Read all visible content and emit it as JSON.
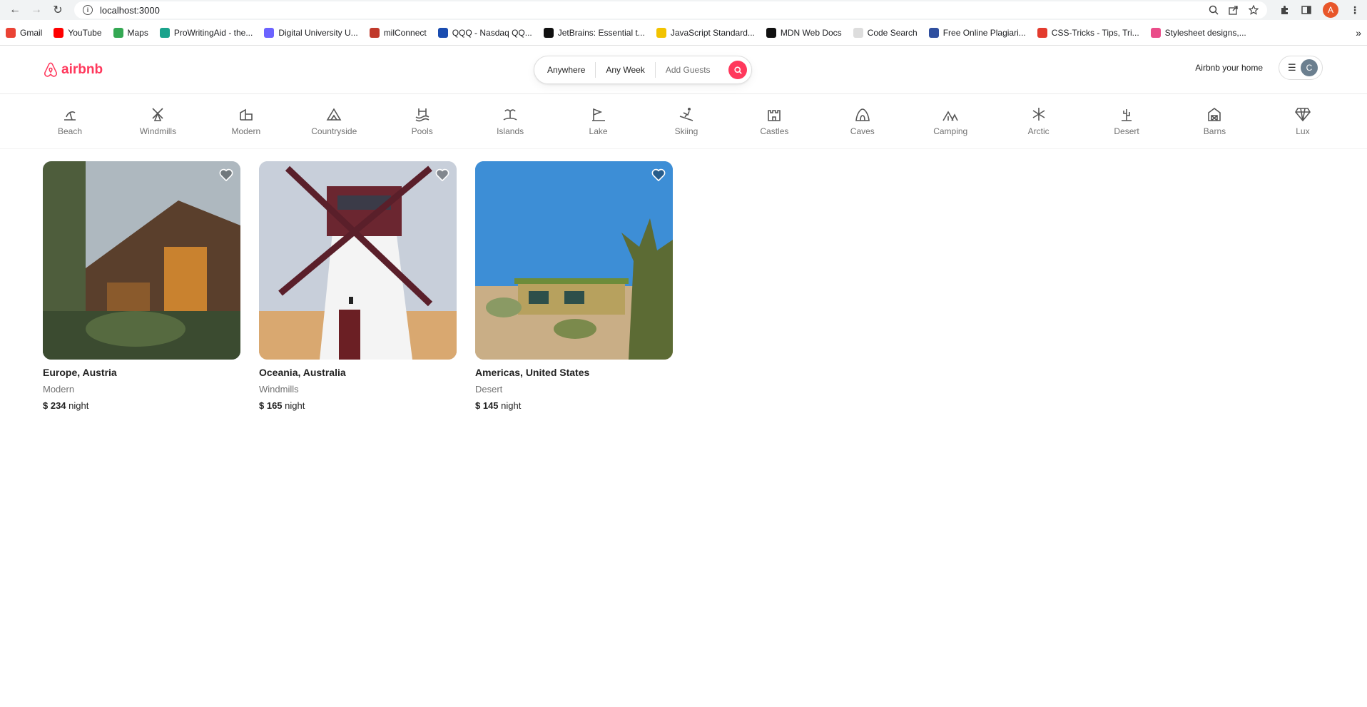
{
  "browser": {
    "url": "localhost:3000",
    "profile_initial": "A",
    "bookmarks": [
      {
        "label": "Gmail",
        "color": "#ea4335"
      },
      {
        "label": "YouTube",
        "color": "#ff0000"
      },
      {
        "label": "Maps",
        "color": "#34a853"
      },
      {
        "label": "ProWritingAid - the...",
        "color": "#1aa38c"
      },
      {
        "label": "Digital University U...",
        "color": "#6c63ff"
      },
      {
        "label": "milConnect",
        "color": "#c0392b"
      },
      {
        "label": "QQQ - Nasdaq QQ...",
        "color": "#1a4cb0"
      },
      {
        "label": "JetBrains: Essential t...",
        "color": "#111111"
      },
      {
        "label": "JavaScript Standard...",
        "color": "#f2c300"
      },
      {
        "label": "MDN Web Docs",
        "color": "#111111"
      },
      {
        "label": "Code Search",
        "color": "#dddddd"
      },
      {
        "label": "Free Online Plagiari...",
        "color": "#2f4f9f"
      },
      {
        "label": "CSS-Tricks - Tips, Tri...",
        "color": "#e33b2e"
      },
      {
        "label": "Stylesheet designs,...",
        "color": "#ea4c89"
      }
    ],
    "more_label": "»"
  },
  "header": {
    "logo_text": "airbnb",
    "search": {
      "anywhere": "Anywhere",
      "any_week": "Any Week",
      "add_guests": "Add Guests"
    },
    "host_link": "Airbnb your home",
    "avatar_initial": "C",
    "brand_color": "#ff385c"
  },
  "categories": [
    {
      "label": "Beach",
      "icon": "beach-icon"
    },
    {
      "label": "Windmills",
      "icon": "windmill-icon"
    },
    {
      "label": "Modern",
      "icon": "modern-icon"
    },
    {
      "label": "Countryside",
      "icon": "countryside-icon"
    },
    {
      "label": "Pools",
      "icon": "pool-icon"
    },
    {
      "label": "Islands",
      "icon": "island-icon"
    },
    {
      "label": "Lake",
      "icon": "lake-icon"
    },
    {
      "label": "Skiing",
      "icon": "skiing-icon"
    },
    {
      "label": "Castles",
      "icon": "castle-icon"
    },
    {
      "label": "Caves",
      "icon": "cave-icon"
    },
    {
      "label": "Camping",
      "icon": "camping-icon"
    },
    {
      "label": "Arctic",
      "icon": "arctic-icon"
    },
    {
      "label": "Desert",
      "icon": "desert-icon"
    },
    {
      "label": "Barns",
      "icon": "barn-icon"
    },
    {
      "label": "Lux",
      "icon": "lux-icon"
    }
  ],
  "listings": [
    {
      "location": "Europe, Austria",
      "category": "Modern",
      "price": "$ 234",
      "unit": "night"
    },
    {
      "location": "Oceania, Australia",
      "category": "Windmills",
      "price": "$ 165",
      "unit": "night"
    },
    {
      "location": "Americas, United States",
      "category": "Desert",
      "price": "$ 145",
      "unit": "night"
    }
  ]
}
